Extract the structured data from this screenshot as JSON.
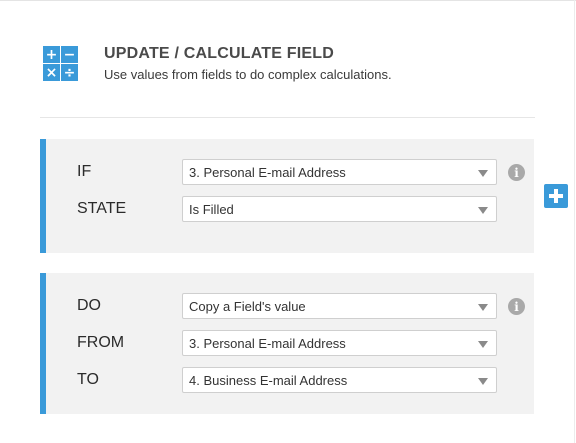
{
  "header": {
    "title": "UPDATE / CALCULATE FIELD",
    "subtitle": "Use values from fields to do complex calculations.",
    "icon_symbols": [
      "+",
      "−",
      "×",
      "÷"
    ],
    "icon_name": "calculator-icon"
  },
  "condition": {
    "rows": [
      {
        "label": "IF",
        "value": "3. Personal E-mail Address"
      },
      {
        "label": "STATE",
        "value": "Is Filled"
      }
    ],
    "info_symbol": "i"
  },
  "action": {
    "rows": [
      {
        "label": "DO",
        "value": "Copy a Field's value"
      },
      {
        "label": "FROM",
        "value": "3. Personal E-mail Address"
      },
      {
        "label": "TO",
        "value": "4. Business E-mail Address"
      }
    ],
    "info_symbol": "i"
  },
  "colors": {
    "accent": "#3a9ad9",
    "panel_bg": "#f2f2f2",
    "info_gray": "#a9a9a9"
  }
}
